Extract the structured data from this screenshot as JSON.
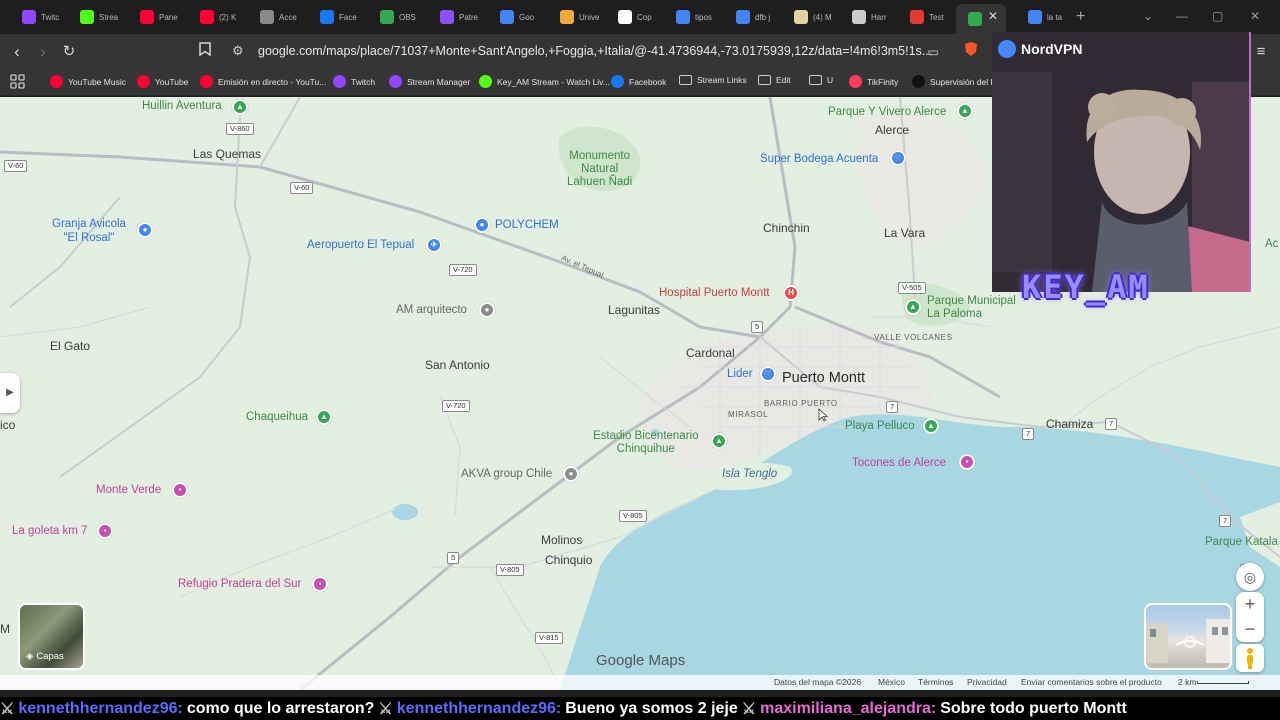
{
  "tabs": [
    {
      "label": "Twitc",
      "color": "#9146ff"
    },
    {
      "label": "Strea",
      "color": "#53fc18"
    },
    {
      "label": "Pane",
      "color": "#ff0033"
    },
    {
      "label": "(2) K",
      "color": "#ff0033"
    },
    {
      "label": "Acce",
      "color": "#8a8a8a"
    },
    {
      "label": "Face",
      "color": "#1877f2"
    },
    {
      "label": "OBS",
      "color": "#34a853"
    },
    {
      "label": "Patre",
      "color": "#8c4fff"
    },
    {
      "label": "Goo",
      "color": "#4285f4"
    },
    {
      "label": "Unive",
      "color": "#f2a93b"
    },
    {
      "label": "Cop",
      "color": "#ffffff"
    },
    {
      "label": "tipos",
      "color": "#4285f4"
    },
    {
      "label": "dfb j",
      "color": "#4285f4"
    },
    {
      "label": "(4) M",
      "color": "#e2d39f"
    },
    {
      "label": "Harr",
      "color": "#cccccc"
    },
    {
      "label": "Test",
      "color": "#e53935"
    },
    {
      "label": "",
      "color": "#34a853"
    },
    {
      "label": "la ta",
      "color": "#4285f4"
    }
  ],
  "address_bar": {
    "url": "google.com/maps/place/71037+Monte+Sant'Angelo,+Foggia,+Italia/@-41.4736944,-73.0175939,12z/data=!4m6!3m5!1s..."
  },
  "bookmarks": [
    {
      "label": "YouTube Music",
      "color": "#ff0033"
    },
    {
      "label": "YouTube",
      "color": "#ff0033"
    },
    {
      "label": "Emisión en directo - YouTu...",
      "color": "#ff0033"
    },
    {
      "label": "Twitch",
      "color": "#9146ff"
    },
    {
      "label": "Stream Manager",
      "color": "#9146ff"
    },
    {
      "label": "Key_AM Stream - Watch Liv...",
      "color": "#53fc18"
    },
    {
      "label": "Facebook",
      "color": "#1877f2"
    },
    {
      "label": "Stream Links",
      "color": "folder"
    },
    {
      "label": "Edit",
      "color": "folder"
    },
    {
      "label": "U",
      "color": "folder"
    },
    {
      "label": "TikFinity",
      "color": "#ff3b5c"
    },
    {
      "label": "Supervisión del LIV",
      "color": "#111111"
    }
  ],
  "map": {
    "places": {
      "huillin": "Huillin Aventura",
      "las_quemas": "Las Quemas",
      "monumento": "Monumento\nNatural\nLahuen Ñadi",
      "super_bodega": "Super Bodega Acuenta",
      "parque_vivero": "Parque Y Vivero Alerce",
      "alerce": "Alerce",
      "granja": "Granja Avicola\n\"El Rosal\"",
      "polychem": "POLYCHEM",
      "aeropuerto": "Aeropuerto El Tepual",
      "chinchin": "Chinchin",
      "la_vara": "La Vara",
      "hospital": "Hospital Puerto Montt",
      "parque_municipal": "Parque Municipal\nLa Paloma",
      "am_arquitecto": "AM arquitecto",
      "lagunitas": "Lagunitas",
      "valle_volcanes": "VALLE VOLCANES",
      "el_gato": "El Gato",
      "cardonal": "Cardonal",
      "san_antonio": "San Antonio",
      "lider": "Lider",
      "puerto_montt": "Puerto Montt",
      "barrio_puerto": "BARRIO PUERTO",
      "mirasol": "MIRASOL",
      "chaqueihua": "Chaqueihua",
      "playa_pelluco": "Playa Pelluco",
      "chamiza": "Chamiza",
      "ico": "ico",
      "estadio": "Estadio Bicentenario\nChinquihue",
      "tocones": "Tocones de Alerce",
      "isla_tenglo": "Isla Tenglo",
      "akva": "AKVA group Chile",
      "monte_verde": "Monte Verde",
      "la_goleta": "La goleta km 7",
      "molinos": "Molinos",
      "chinquio": "Chinquio",
      "refugio": "Refugio Pradera del Sur",
      "parque_katala": "Parque Katala",
      "ac": "Ac",
      "m_left": "M"
    },
    "roads": {
      "v860": "V-860",
      "v60": "V-60",
      "v60b": "V-60",
      "v720": "V-720",
      "tepual": "Av. el Tepual",
      "v720b": "V-720",
      "r5a": "5",
      "r5b": "5",
      "r7a": "7",
      "r7b": "7",
      "r7c": "7",
      "r7d": "7",
      "r7e": "7",
      "v805a": "V-805",
      "v805b": "V-805",
      "v815": "V-815",
      "v505": "V-505"
    },
    "layers_label": "Capas",
    "logo_text": "Google Maps",
    "attribution": {
      "data": "Datos del mapa ©2026",
      "country": "México",
      "terms": "Términos",
      "privacy": "Privacidad",
      "feedback": "Enviar comentarios sobre el producto",
      "scale": "2 km"
    }
  },
  "webcam": {
    "vpn_label": "NordVPN",
    "overlay_text": "KEY_AM"
  },
  "chat": [
    {
      "user": "kennethhernandez96:",
      "message": "como que lo arrestaron?",
      "style": "blue"
    },
    {
      "user": "kennethhernandez96:",
      "message": "Bueno ya somos 2 jeje",
      "style": "blue"
    },
    {
      "user": "maximiliana_alejandra:",
      "message": "Sobre todo puerto Montt",
      "style": "pink"
    }
  ]
}
